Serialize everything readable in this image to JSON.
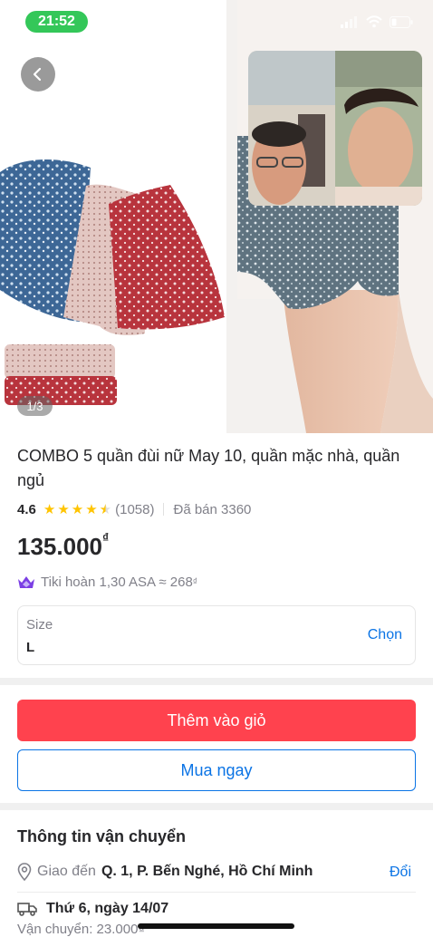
{
  "status_bar": {
    "time": "21:52"
  },
  "gallery": {
    "counter": "1/3"
  },
  "product": {
    "title": "COMBO 5 quần đùi nữ May 10, quần mặc nhà, quần ngủ",
    "rating": "4.6",
    "stars": 4.5,
    "review_count": "(1058)",
    "sold": "Đã bán 3360",
    "price": "135.000",
    "currency": "₫",
    "cashback": "Tiki hoàn 1,30 ASA ≈ 268",
    "cashback_currency": "₫"
  },
  "size_selector": {
    "label": "Size",
    "value": "L",
    "choose": "Chọn"
  },
  "actions": {
    "add_to_cart": "Thêm vào giỏ",
    "buy_now": "Mua ngay"
  },
  "shipping": {
    "title": "Thông tin vận chuyển",
    "deliver_to_label": "Giao đến",
    "address": "Q. 1, P. Bến Nghé, Hồ Chí Minh",
    "change": "Đổi",
    "date": "Thứ 6, ngày 14/07",
    "fee": "Vận chuyển: 23.000₫"
  },
  "colors": {
    "accent": "#0b74e5",
    "cart_button": "#ff424e",
    "star": "#ffc400",
    "status_green": "#34c759"
  }
}
